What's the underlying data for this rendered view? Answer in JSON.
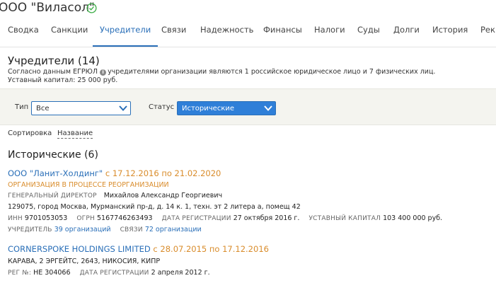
{
  "header": {
    "company_name": "ООО \"Виласол\""
  },
  "tabs": [
    "Сводка",
    "Санкции",
    "Учредители",
    "Связи",
    "Надежность",
    "Финансы",
    "Налоги",
    "Суды",
    "Долги",
    "История",
    "Рек"
  ],
  "section": {
    "title": "Учредители (14)",
    "info_prefix": "Согласно данным ЕГРЮЛ",
    "info_rest": "учредителями организации являются 1 российское юридическое лицо и 7 физических лиц.",
    "capital": "Уставный капитал: 25 000 руб."
  },
  "filters": {
    "type_label": "Тип",
    "type_value": "Все",
    "status_label": "Статус",
    "status_value": "Исторические"
  },
  "sort": {
    "label": "Сортировка",
    "value": "Название"
  },
  "historical": {
    "title": "Исторические (6)",
    "records": [
      {
        "name": "ООО \"Ланит-Холдинг\"",
        "dates": " с 17.12.2016 по 21.02.2020",
        "status": "ОРГАНИЗАЦИЯ В ПРОЦЕССЕ РЕОРГАНИЗАЦИИ",
        "director_label": "ГЕНЕРАЛЬНЫЙ ДИРЕКТОР",
        "director_value": "Михайлов Александр Георгиевич",
        "address": "129075, город Москва, Мурманский пр-д, д. 14 к. 1, техн. эт 2 литера а, помещ 42",
        "inn_label": "ИНН",
        "inn_value": "9701053053",
        "ogrn_label": "ОГРН",
        "ogrn_value": "5167746263493",
        "reg_label": "ДАТА РЕГИСТРАЦИИ",
        "reg_value": "27 октября 2016 г.",
        "capital_label": "УСТАВНЫЙ КАПИТАЛ",
        "capital_value": "103 400 000 руб.",
        "founder_label": "УЧРЕДИТЕЛЬ",
        "founder_value": "39 организаций",
        "links_label": "СВЯЗИ",
        "links_value": "72 организации"
      },
      {
        "name": "CORNERSPOKE HOLDINGS LIMITED",
        "dates": " с 28.07.2015 по 17.12.2016",
        "address": "КАРАВА, 2 ЭРГЕЙТС, 2643, НИКОСИЯ, КИПР",
        "regno_label": "РЕГ №:",
        "regno_value": "HE 304066",
        "reg_label": "ДАТА РЕГИСТРАЦИИ",
        "reg_value": "2 апреля 2012 г."
      }
    ]
  }
}
